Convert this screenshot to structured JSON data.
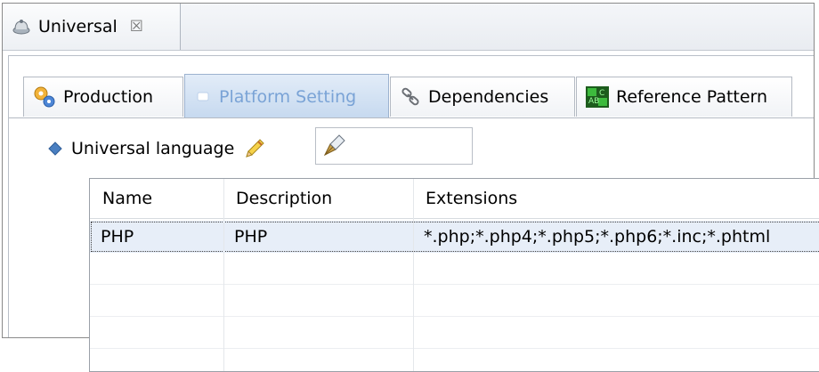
{
  "editor": {
    "tab_title": "Universal",
    "close_glyph": "☒"
  },
  "tabs": [
    {
      "label": "Production",
      "icon": "gears-icon",
      "active": false
    },
    {
      "label": "Platform Setting",
      "icon": "platform-icon",
      "active": true
    },
    {
      "label": "Dependencies",
      "icon": "chain-icon",
      "active": false
    },
    {
      "label": "Reference Pattern",
      "icon": "abc-pattern-icon",
      "active": false
    }
  ],
  "language": {
    "label": "Universal language",
    "value": ""
  },
  "table": {
    "columns": [
      "Name",
      "Description",
      "Extensions"
    ],
    "rows": [
      {
        "name": "PHP",
        "description": "PHP",
        "extensions": "*.php;*.php4;*.php5;*.php6;*.inc;*.phtml"
      }
    ]
  },
  "colors": {
    "active_tab_text": "#7aa3d6",
    "selection": "#e7eef8"
  }
}
